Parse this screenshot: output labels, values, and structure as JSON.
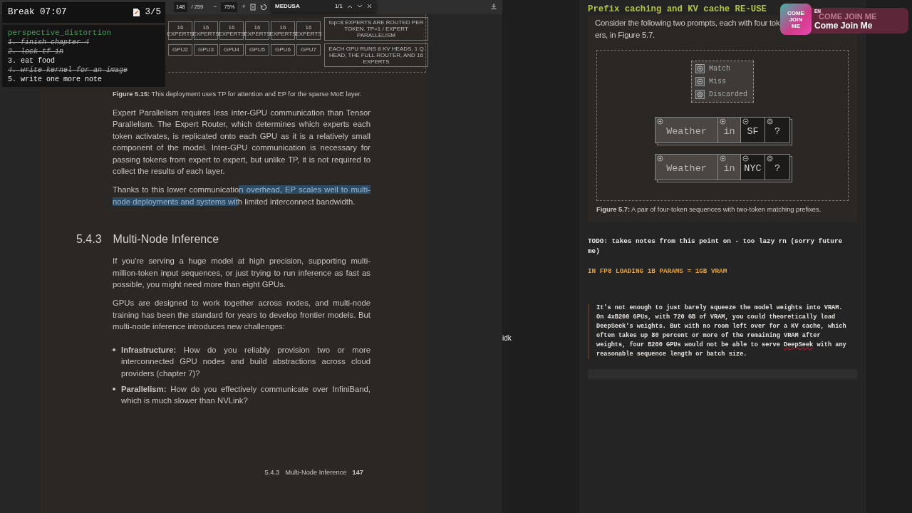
{
  "pdf_viewer": {
    "toolbar": {
      "page_current": "148",
      "page_total": "/ 259",
      "zoom_out": "−",
      "zoom": "75%",
      "zoom_in": "+"
    },
    "find_bar": {
      "query": "MEDUSA",
      "count": "1/1"
    }
  },
  "document": {
    "top_figure": {
      "expert_boxes": [
        "16 EXPERTS",
        "16 EXPERTS",
        "16 EXPERTS",
        "16 EXPERTS",
        "16 EXPERTS",
        "16 EXPERTS"
      ],
      "gpu_boxes": [
        "GPU2",
        "GPU3",
        "GPU4",
        "GPU5",
        "GPU6",
        "GPU7"
      ],
      "notes": [
        "top=8 EXPERTS ARE ROUTED PER TOKEN. TP=1 / EXPERT PARALLELISM",
        "EACH GPU RUNS 8 KV HEADS, 1 Q HEAD, THE FULL ROUTER, AND 16 EXPERTS"
      ],
      "caption": "**Figure 5.15:** This deployment uses TP for attention and EP for the sparse MoE layer."
    },
    "blocks": [
      {
        "kind": "paragraph",
        "segments": [
          {
            "text": "Expert Parallelism requires less inter-GPU communication than Tensor Parallelism. The Expert Router, which determines which experts each token activates, is replicated onto each GPU as it is a relatively small component of the model. Inter-GPU communication is necessary for passing tokens from expert to expert, but unlike TP, it is not required to collect the results of each layer.",
            "highlighted": false
          }
        ]
      },
      {
        "kind": "paragraph",
        "segments": [
          {
            "text": "Thanks to this lower communicatio",
            "highlighted": false
          },
          {
            "text": "n overhead, EP scales well to multi-node deployments and systems wit",
            "highlighted": true
          },
          {
            "text": "h limited interconnect bandwidth.",
            "highlighted": false
          }
        ]
      },
      {
        "kind": "heading",
        "number": "5.4.3",
        "title": "Multi-Node Inference"
      },
      {
        "kind": "paragraph",
        "segments": [
          {
            "text": "If you’re serving a huge model at high precision, supporting multi-million-token input sequences, or just trying to run inference as fast as possible, you might need more than eight GPUs.",
            "highlighted": false
          }
        ]
      },
      {
        "kind": "paragraph",
        "segments": [
          {
            "text": "GPUs are designed to work together across nodes, and multi-node training has been the standard for years to develop frontier models. But multi-node inference introduces new challenges:",
            "highlighted": false
          }
        ]
      },
      {
        "kind": "bullet",
        "text": "**Infrastructure:** How do you reliably provision two or more interconnected GPU nodes and build abstractions across cloud providers (chapter 7)?"
      },
      {
        "kind": "bullet",
        "text": "**Parallelism:** How do you effectively communicate over InfiniBand, which is much slower than NVLink?"
      }
    ],
    "footer": {
      "section": "5.4.3",
      "title": "Multi-Node Inference",
      "page": "147"
    }
  },
  "middle_note": "idk",
  "notes": {
    "heading": "Prefix caching and KV cache RE-USE",
    "excerpt_lines": [
      "Consider the following two prompts, each with four tok",
      "ers, in Figure 5.7."
    ],
    "legend": [
      {
        "label": "Match",
        "kind": "match"
      },
      {
        "label": "Miss",
        "kind": "miss"
      },
      {
        "label": "Discarded",
        "kind": "discarded"
      }
    ],
    "sequences": [
      [
        {
          "text": "Weather",
          "kind": "match"
        },
        {
          "text": "in",
          "kind": "match"
        },
        {
          "text": "SF",
          "kind": "miss"
        },
        {
          "text": "?",
          "kind": "discarded"
        }
      ],
      [
        {
          "text": "Weather",
          "kind": "match"
        },
        {
          "text": "in",
          "kind": "match"
        },
        {
          "text": "NYC",
          "kind": "miss"
        },
        {
          "text": "?",
          "kind": "discarded"
        }
      ]
    ],
    "figure_caption": "**Figure 5.7:** A pair of four-token sequences with two-token matching prefixes.",
    "todo_line": "TODO: takes notes from this point on - too lazy rn (sorry future me)",
    "highlight_line": "IN FP8 LOADING 1B PARAMS = 1GB VRAM",
    "quote": [
      {
        "text": "It's not enough to just barely squeeze the model weights into VRAM. On 4xB200 GPUs, with 720 GB of VRAM, you could theoretically load DeepSeek's weights. But with no room left over for a KV cache, which often takes up 80 percent or more of the remaining VRAM after weights, four B200 GPUs would not be able to serve ",
        "misspelled": false
      },
      {
        "text": "DeepSeek",
        "misspelled": true
      },
      {
        "text": " with any reasonable sequence length or batch size.",
        "misspelled": false
      }
    ]
  },
  "timer": {
    "label": "Break 07:07",
    "count": "3/5"
  },
  "todo": {
    "title": "perspective_distortion",
    "items": [
      {
        "text": "1. finish chapter 4",
        "done": true
      },
      {
        "text": "2. lock tf in",
        "done": true
      },
      {
        "text": "3. eat food",
        "done": false
      },
      {
        "text": "4. write kernel for an image",
        "done": true
      },
      {
        "text": "5. write one more note",
        "done": false
      }
    ]
  },
  "stream_overlay": {
    "icon_text": "COME JOIN ME",
    "language": "EN",
    "ghost_title": "COME JOIN ME",
    "title": "Come Join Me"
  }
}
